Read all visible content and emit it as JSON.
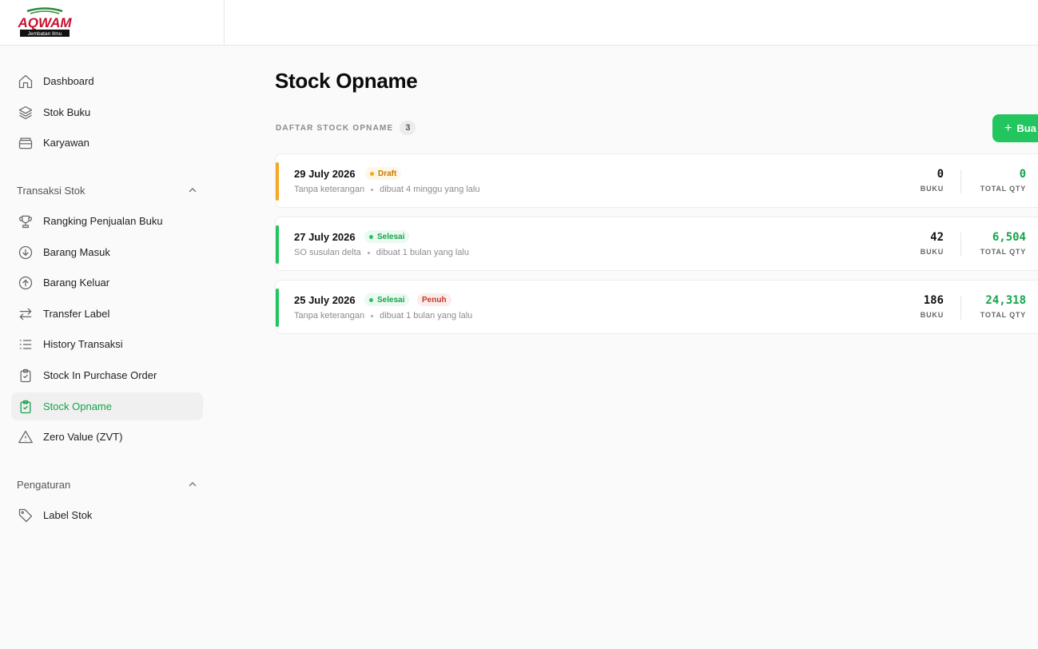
{
  "brand": {
    "logo_text": "AQWAM",
    "logo_tagline": "Jembatan Ilmu",
    "colors": {
      "logo_red": "#c8102e",
      "logo_green": "#2e8b3a",
      "accent": "#22c55e"
    }
  },
  "sidebar": {
    "items": [
      {
        "label": "Dashboard",
        "icon": "home-icon"
      },
      {
        "label": "Stok Buku",
        "icon": "layers-icon"
      },
      {
        "label": "Karyawan",
        "icon": "archive-icon"
      }
    ],
    "sections": [
      {
        "label": "Transaksi Stok",
        "expanded": true,
        "items": [
          {
            "label": "Rangking Penjualan Buku",
            "icon": "trophy-icon"
          },
          {
            "label": "Barang Masuk",
            "icon": "arrow-down-circle-icon"
          },
          {
            "label": "Barang Keluar",
            "icon": "arrow-up-circle-icon"
          },
          {
            "label": "Transfer Label",
            "icon": "arrows-swap-icon"
          },
          {
            "label": "History Transaksi",
            "icon": "list-icon"
          },
          {
            "label": "Stock In Purchase Order",
            "icon": "clipboard-icon"
          },
          {
            "label": "Stock Opname",
            "icon": "clipboard-check-icon",
            "active": true
          },
          {
            "label": "Zero Value (ZVT)",
            "icon": "warning-triangle-icon"
          }
        ]
      },
      {
        "label": "Pengaturan",
        "expanded": true,
        "items": [
          {
            "label": "Label Stok",
            "icon": "tag-icon"
          }
        ]
      }
    ]
  },
  "main": {
    "title": "Stock Opname",
    "list_label": "DAFTAR STOCK OPNAME",
    "count": "3",
    "create_button": "Bua",
    "books_caption": "BUKU",
    "qty_caption": "TOTAL QTY",
    "records": [
      {
        "date": "29 July 2026",
        "status": "Draft",
        "extra_badge": "",
        "note": "Tanpa keterangan",
        "created": "dibuat 4 minggu yang lalu",
        "books": "0",
        "qty": "0",
        "color": "#f5a623"
      },
      {
        "date": "27 July 2026",
        "status": "Selesai",
        "extra_badge": "",
        "note": "SO susulan delta",
        "created": "dibuat 1 bulan yang lalu",
        "books": "42",
        "qty": "6,504",
        "color": "#22c55e"
      },
      {
        "date": "25 July 2026",
        "status": "Selesai",
        "extra_badge": "Penuh",
        "note": "Tanpa keterangan",
        "created": "dibuat 1 bulan yang lalu",
        "books": "186",
        "qty": "24,318",
        "color": "#22c55e"
      }
    ]
  }
}
